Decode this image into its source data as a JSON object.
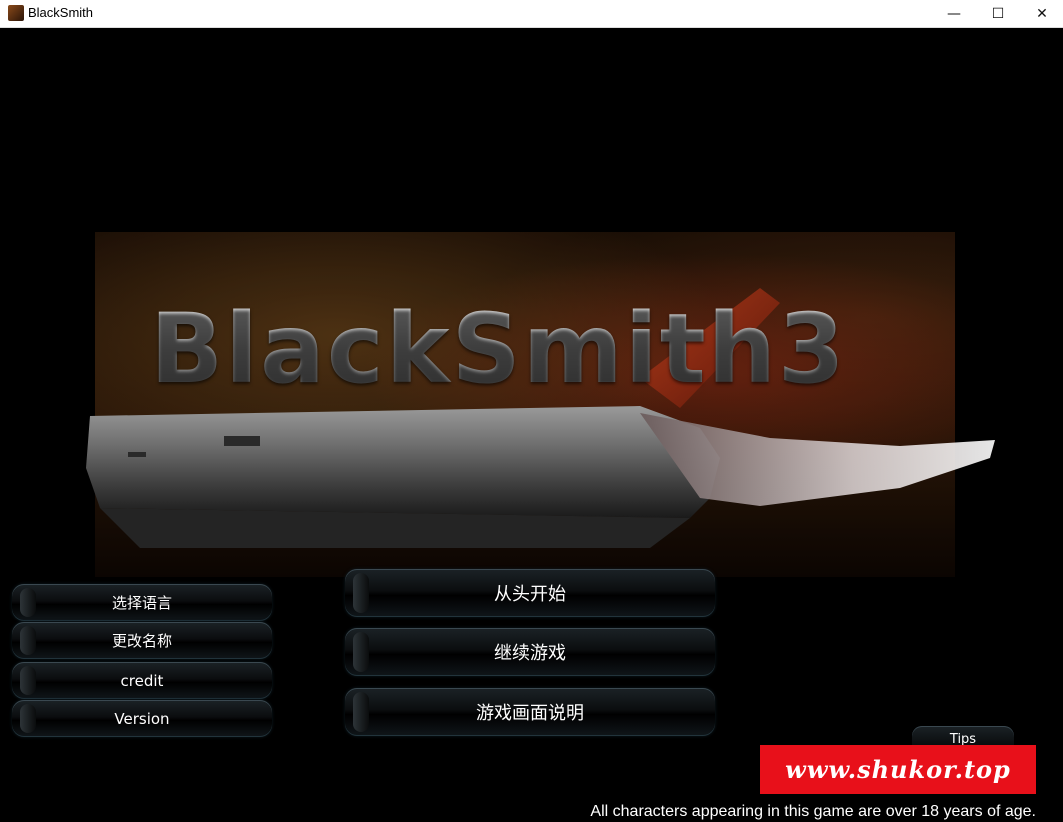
{
  "window": {
    "title": "BlackSmith",
    "minimize_glyph": "—",
    "maximize_glyph": "☐",
    "close_glyph": "✕"
  },
  "game": {
    "logo_text": "BlackSmith3",
    "left_menu": [
      "选择语言",
      "更改名称",
      "credit",
      "Version"
    ],
    "main_menu": [
      "从头开始",
      "继续游戏",
      "游戏画面说明"
    ],
    "tips_label": "Tips",
    "watermark": "www.shukor.top",
    "disclaimer": "All characters appearing in this game are over 18 years of age.",
    "colors": {
      "background": "#000000",
      "watermark_bg": "#e8101a",
      "button_border": "#3a4850"
    }
  }
}
